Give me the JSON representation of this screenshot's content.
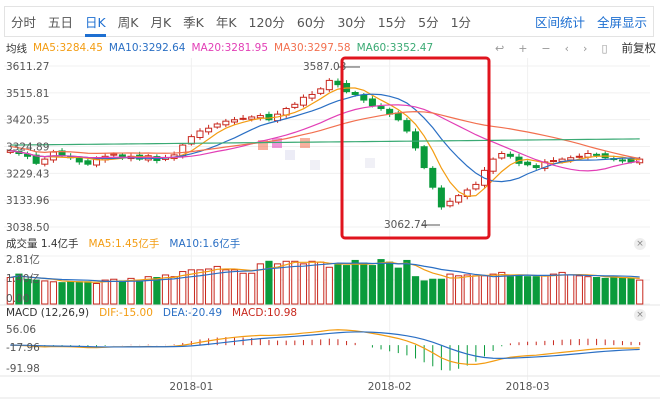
{
  "tabs": [
    "分时",
    "五日",
    "日K",
    "周K",
    "月K",
    "季K",
    "年K",
    "120分",
    "60分",
    "30分",
    "15分",
    "5分",
    "1分"
  ],
  "active_tab": 2,
  "links": {
    "interval_stats": "区间统计",
    "fullscreen": "全屏显示"
  },
  "ma": {
    "label": "均线",
    "ma5": "MA5:3284.45",
    "ma10": "MA10:3292.64",
    "ma20": "MA20:3281.95",
    "ma30": "MA30:3297.58",
    "ma60": "MA60:3352.47"
  },
  "tools": {
    "adjust": "前复权"
  },
  "volume": {
    "label": "成交量 1.4亿手",
    "ma5": "MA5:1.45亿手",
    "ma10": "MA10:1.6亿手"
  },
  "macd": {
    "label": "MACD (12,26,9)",
    "dif": "DIF:-15.00",
    "dea": "DEA:-20.49",
    "macd": "MACD:10.98"
  },
  "colors": {
    "up": "#c8281e",
    "down": "#0a9b3c",
    "ma5": "#f39c12",
    "ma10": "#2a6fc4",
    "ma20": "#e23fb6",
    "ma30": "#f2704f",
    "ma60": "#3aaa74",
    "box": "#e0141e"
  },
  "chart_data": {
    "type": "candlestick",
    "price_axis": [
      "3611.27",
      "3515.81",
      "3420.35",
      "3324.89",
      "3229.43",
      "3133.96",
      "3038.50"
    ],
    "ylim": [
      3038.5,
      3611.27
    ],
    "annotations": {
      "high": "3587.03",
      "low": "3062.74"
    },
    "volume_axis": [
      "2.81亿",
      "1.40亿",
      "0.00"
    ],
    "volume_max": 2.81,
    "macd_axis": [
      "56.06",
      "-17.96",
      "-91.98"
    ],
    "macd_lim": [
      -91.98,
      56.06
    ],
    "x_labels": [
      {
        "text": "2018-01",
        "index": 21
      },
      {
        "text": "2018-02",
        "index": 44
      },
      {
        "text": "2018-03",
        "index": 60
      }
    ],
    "closes": [
      3310,
      3300,
      3290,
      3265,
      3280,
      3305,
      3292,
      3285,
      3270,
      3262,
      3280,
      3290,
      3298,
      3285,
      3290,
      3280,
      3292,
      3275,
      3285,
      3295,
      3330,
      3360,
      3380,
      3390,
      3405,
      3415,
      3420,
      3425,
      3430,
      3435,
      3420,
      3440,
      3460,
      3475,
      3500,
      3510,
      3530,
      3560,
      3545,
      3520,
      3510,
      3490,
      3470,
      3460,
      3440,
      3420,
      3380,
      3320,
      3250,
      3180,
      3110,
      3130,
      3150,
      3170,
      3190,
      3240,
      3280,
      3300,
      3290,
      3265,
      3260,
      3250,
      3270,
      3275,
      3280,
      3285,
      3290,
      3300,
      3295,
      3285,
      3280,
      3275,
      3270,
      3280
    ],
    "volumes": [
      1.55,
      1.75,
      1.45,
      1.4,
      1.35,
      1.3,
      1.25,
      1.3,
      1.3,
      1.3,
      1.2,
      1.4,
      1.45,
      1.35,
      1.5,
      1.35,
      1.6,
      1.55,
      1.7,
      1.6,
      1.9,
      2.0,
      2.0,
      2.05,
      2.2,
      2.0,
      2.0,
      1.8,
      1.8,
      2.35,
      2.5,
      2.35,
      2.5,
      2.5,
      2.35,
      2.5,
      2.45,
      2.15,
      2.3,
      2.25,
      2.55,
      2.4,
      2.25,
      2.6,
      2.45,
      2.1,
      2.55,
      1.6,
      1.35,
      1.45,
      1.45,
      1.75,
      1.65,
      1.7,
      1.65,
      1.65,
      1.75,
      1.85,
      1.6,
      1.7,
      1.6,
      1.6,
      1.65,
      1.75,
      1.85,
      1.7,
      1.65,
      1.6,
      1.55,
      1.5,
      1.6,
      1.5,
      1.5,
      1.4
    ]
  }
}
